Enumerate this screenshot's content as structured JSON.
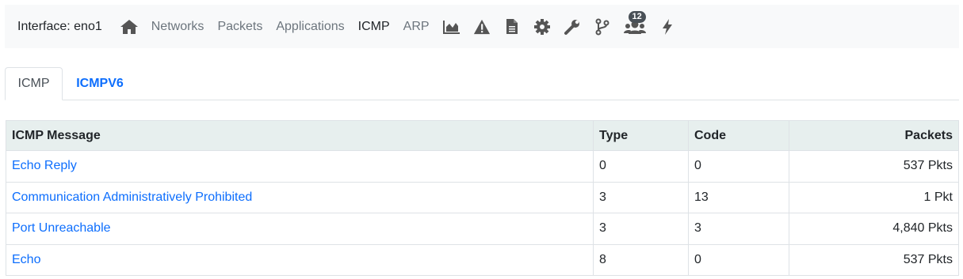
{
  "header": {
    "interface_label": "Interface: eno1",
    "nav": {
      "home_icon": "home-icon",
      "networks": "Networks",
      "packets": "Packets",
      "applications": "Applications",
      "icmp": "ICMP",
      "arp": "ARP",
      "icons": [
        "chart-area-icon",
        "warning-icon",
        "document-icon",
        "gear-icon",
        "wrench-icon",
        "branch-icon",
        "users-icon",
        "bolt-icon"
      ],
      "users_badge": "12"
    }
  },
  "tabs": {
    "active": "ICMP",
    "inactive": "ICMPV6"
  },
  "table": {
    "columns": [
      "ICMP Message",
      "Type",
      "Code",
      "Packets"
    ],
    "rows": [
      {
        "message": "Echo Reply",
        "type": "0",
        "code": "0",
        "packets": "537 Pkts"
      },
      {
        "message": "Communication Administratively Prohibited",
        "type": "3",
        "code": "13",
        "packets": "1 Pkt"
      },
      {
        "message": "Port Unreachable",
        "type": "3",
        "code": "3",
        "packets": "4,840 Pkts"
      },
      {
        "message": "Echo",
        "type": "8",
        "code": "0",
        "packets": "537 Pkts"
      }
    ]
  },
  "colors": {
    "link": "#0d6efd",
    "header_bg": "#e7efee",
    "navbar_bg": "#f8f9fa",
    "muted": "#6c757d",
    "icon": "#555555"
  }
}
